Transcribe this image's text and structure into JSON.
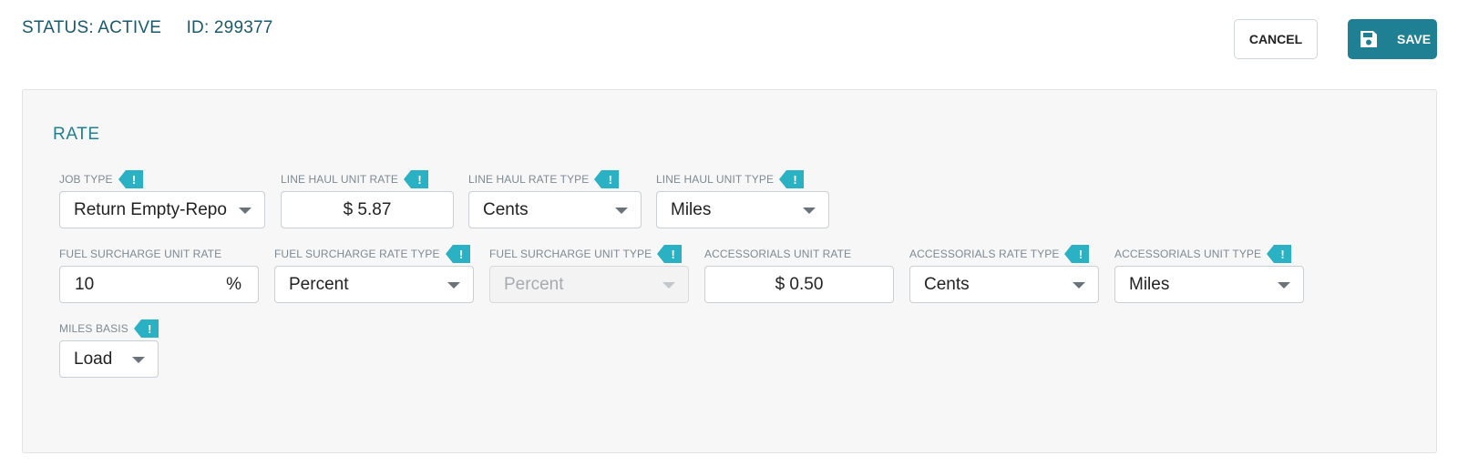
{
  "header": {
    "status": "STATUS: ACTIVE",
    "id": "ID: 299377",
    "cancel_label": "CANCEL",
    "save_label": "SAVE"
  },
  "section": {
    "title": "RATE"
  },
  "fields": {
    "job_type": {
      "label": "JOB TYPE",
      "value": "Return Empty-Repo"
    },
    "line_haul_unit_rate": {
      "label": "LINE HAUL UNIT RATE",
      "value": "$ 5.87"
    },
    "line_haul_rate_type": {
      "label": "LINE HAUL RATE TYPE",
      "value": "Cents"
    },
    "line_haul_unit_type": {
      "label": "LINE HAUL UNIT TYPE",
      "value": "Miles"
    },
    "fuel_surcharge_unit_rate": {
      "label": "FUEL SURCHARGE UNIT RATE",
      "value": "10",
      "unit": "%"
    },
    "fuel_surcharge_rate_type": {
      "label": "FUEL SURCHARGE RATE TYPE",
      "value": "Percent"
    },
    "fuel_surcharge_unit_type": {
      "label": "FUEL SURCHARGE UNIT TYPE",
      "value": "Percent"
    },
    "accessorials_unit_rate": {
      "label": "ACCESSORIALS UNIT RATE",
      "value": "$ 0.50"
    },
    "accessorials_rate_type": {
      "label": "ACCESSORIALS RATE TYPE",
      "value": "Cents"
    },
    "accessorials_unit_type": {
      "label": "ACCESSORIALS UNIT TYPE",
      "value": "Miles"
    },
    "miles_basis": {
      "label": "MILES BASIS",
      "value": "Load"
    }
  },
  "info_tag_text": "!",
  "colors": {
    "accent": "#1f7f93",
    "tag": "#2bb1c4",
    "status_text": "#1a5a6b"
  }
}
